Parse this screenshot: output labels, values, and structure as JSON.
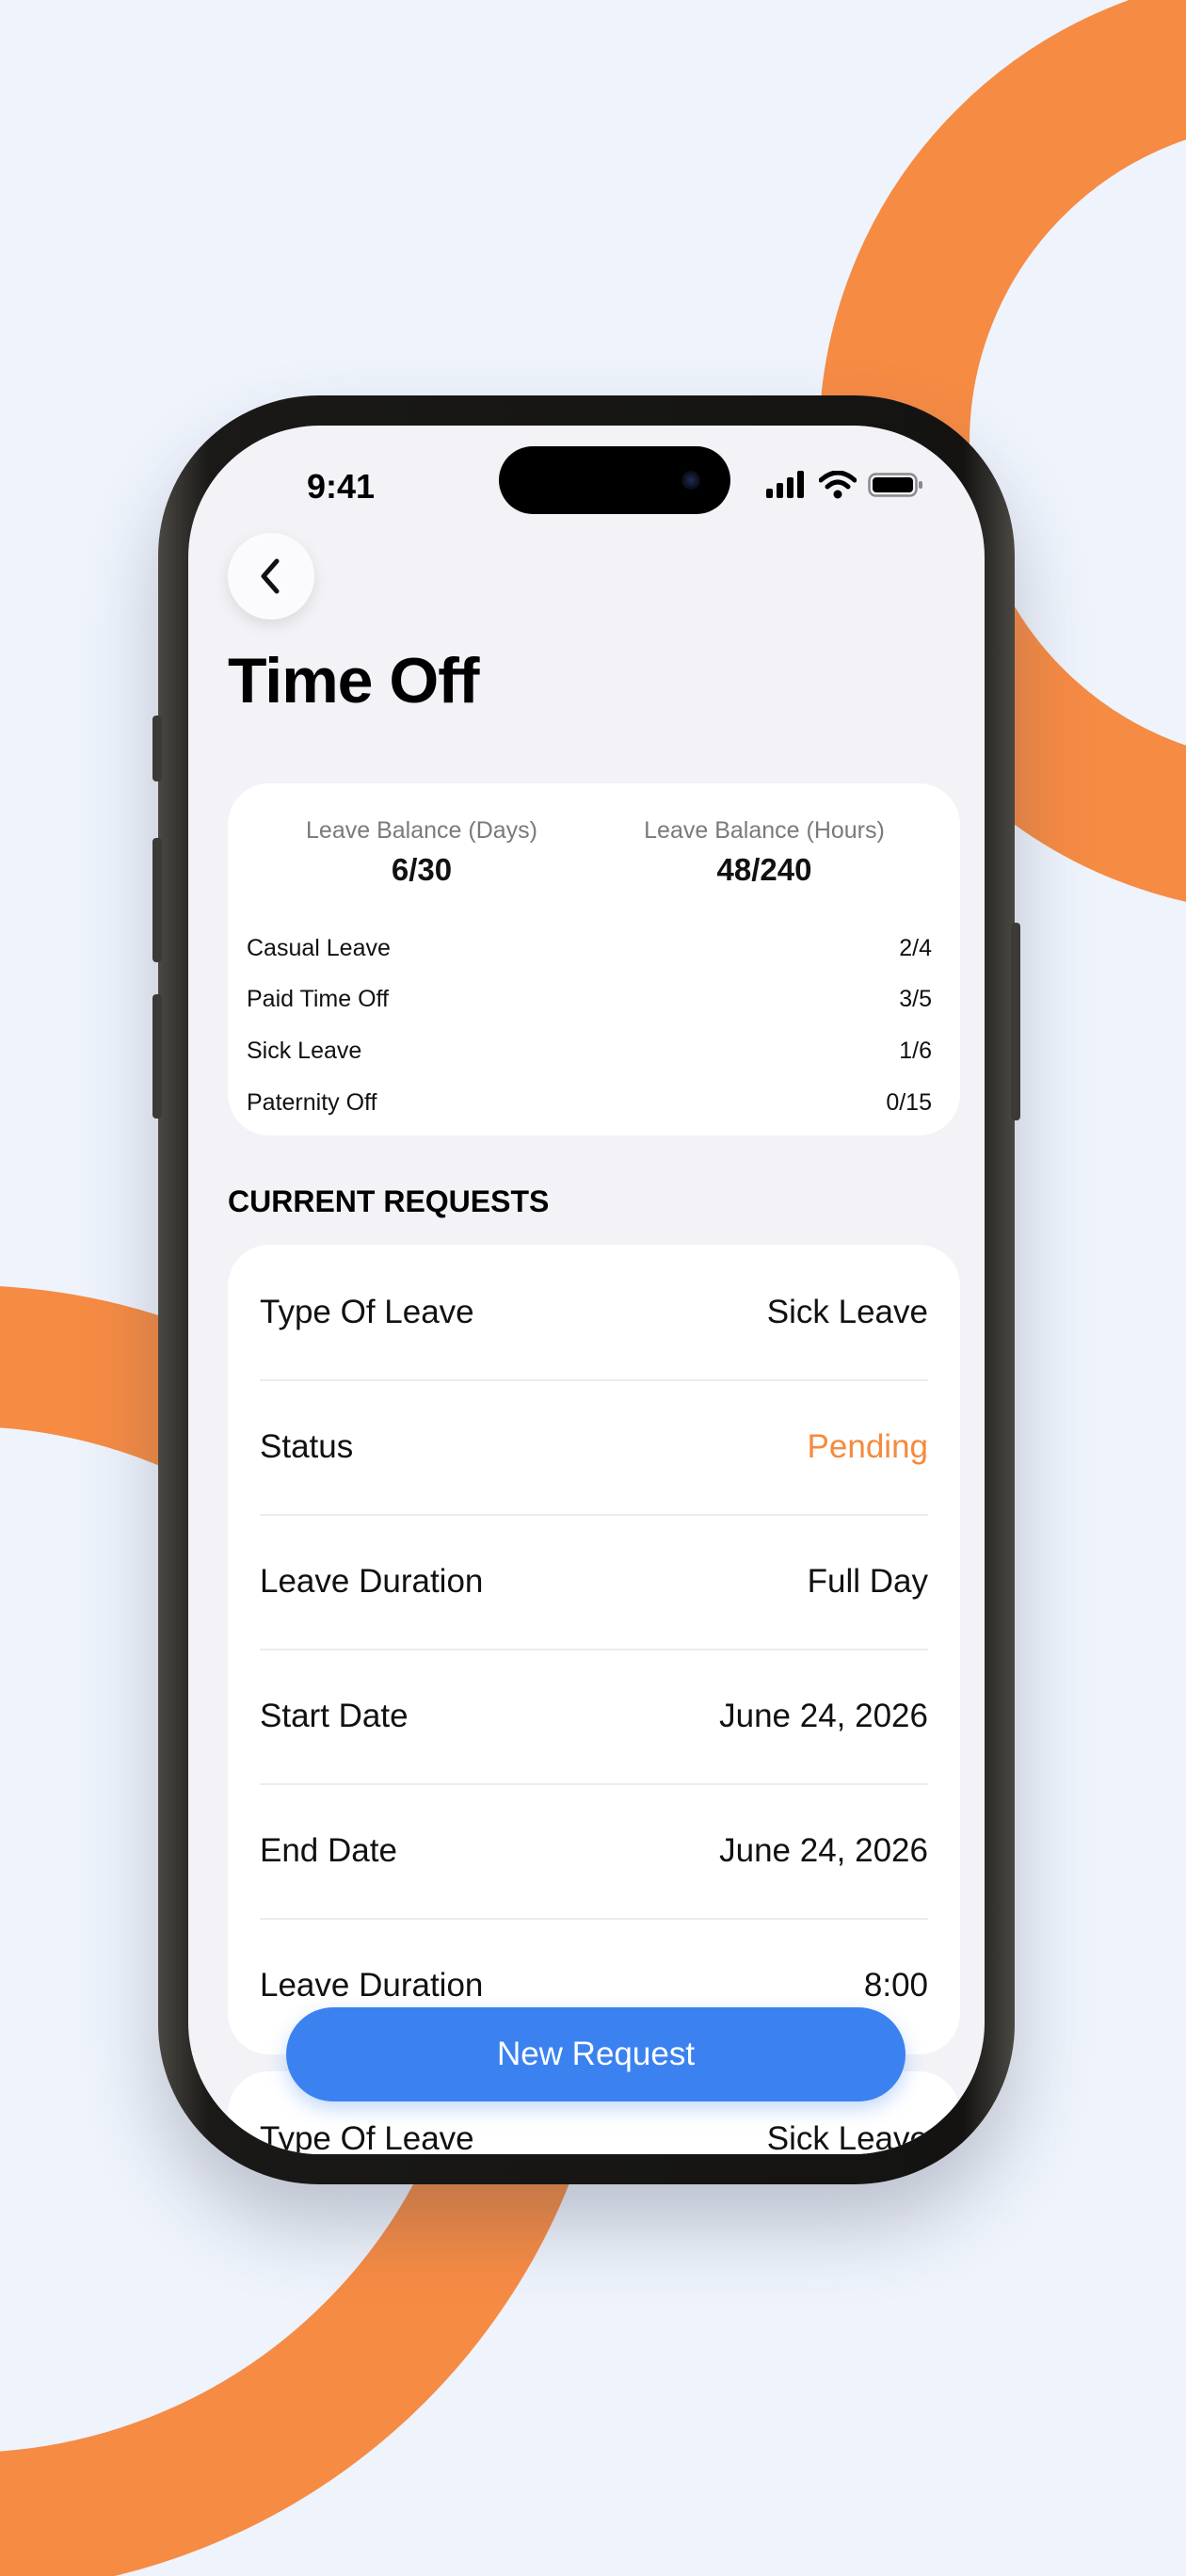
{
  "status_bar": {
    "time": "9:41"
  },
  "header": {
    "title": "Time Off"
  },
  "balance": {
    "days": {
      "label": "Leave Balance (Days)",
      "value": "6/30"
    },
    "hours": {
      "label": "Leave Balance (Hours)",
      "value": "48/240"
    },
    "items": [
      {
        "label": "Casual Leave",
        "value": "2/4"
      },
      {
        "label": "Paid Time Off",
        "value": "3/5"
      },
      {
        "label": "Sick Leave",
        "value": "1/6"
      },
      {
        "label": "Paternity Off",
        "value": "0/15"
      }
    ]
  },
  "current_requests": {
    "title": "CURRENT REQUESTS",
    "request_1": [
      {
        "label": "Type Of Leave",
        "value": "Sick Leave"
      },
      {
        "label": "Status",
        "value": "Pending"
      },
      {
        "label": "Leave Duration",
        "value": "Full Day"
      },
      {
        "label": "Start Date",
        "value": "June 24, 2026"
      },
      {
        "label": "End Date",
        "value": "June 24, 2026"
      },
      {
        "label": "Leave Duration",
        "value": "8:00"
      }
    ],
    "request_2": [
      {
        "label": "Type Of Leave",
        "value": "Sick Leave"
      }
    ]
  },
  "actions": {
    "new_request_label": "New Request"
  },
  "colors": {
    "accent_orange": "#f58a3d",
    "primary_blue": "#3b82f0",
    "background": "#eef3fc"
  }
}
